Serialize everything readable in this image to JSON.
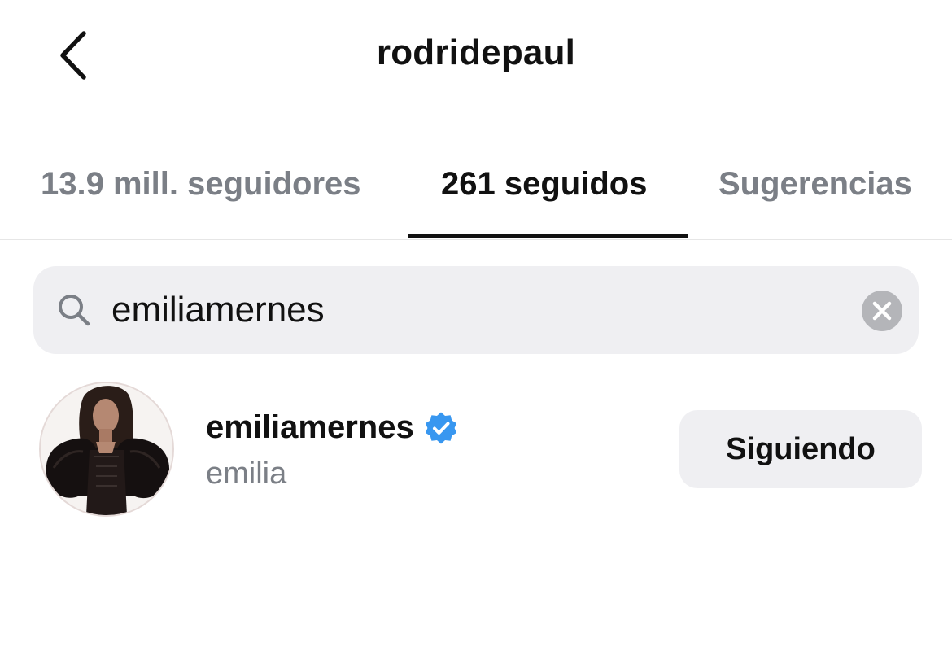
{
  "header": {
    "title": "rodridepaul"
  },
  "tabs": [
    {
      "label": "13.9 mill. seguidores",
      "active": false
    },
    {
      "label": "261 seguidos",
      "active": true
    },
    {
      "label": "Sugerencias",
      "active": false
    }
  ],
  "search": {
    "value": "emiliamernes",
    "icon": "search-icon",
    "clear_icon": "clear-icon"
  },
  "results": [
    {
      "username": "emiliamernes",
      "verified": true,
      "full_name": "emilia",
      "button_label": "Siguiendo"
    }
  ],
  "colors": {
    "verified_blue": "#3897f0",
    "secondary_text": "#7b7f86",
    "surface": "#efeff2"
  }
}
